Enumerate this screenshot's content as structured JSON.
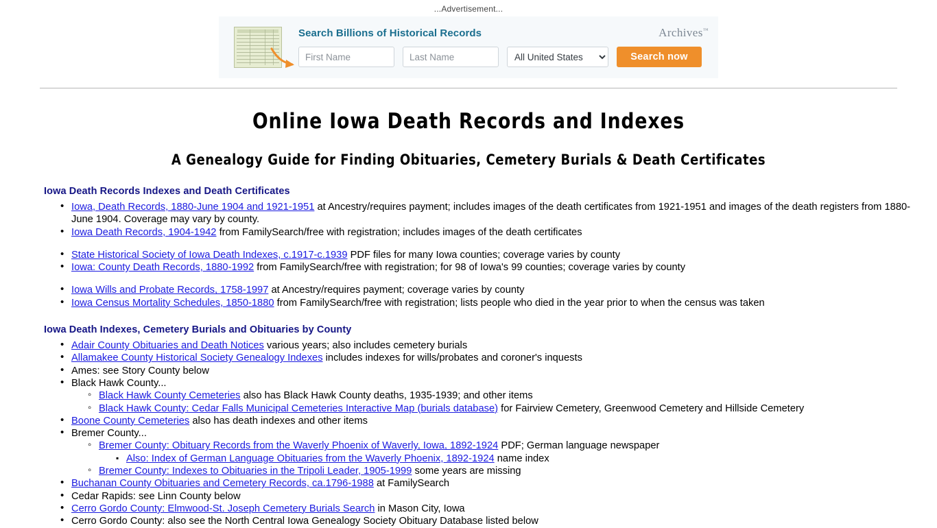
{
  "advertisement": {
    "label": "...Advertisement...",
    "headline": "Search Billions of Historical Records",
    "brand": "Archives",
    "brand_tm": "™",
    "thumbnail_name": "death-certificate-thumbnail",
    "arrow_name": "orange-arrow-pointing-to-first-name",
    "first_name_placeholder": "First Name",
    "first_name_value": "",
    "last_name_placeholder": "Last Name",
    "last_name_value": "",
    "location_selected": "All United States",
    "location_options": [
      "All United States"
    ],
    "search_button": "Search now",
    "accent_color": "#ef8f2b",
    "headline_color": "#1a6e8e",
    "box_background": "#f6f9fb"
  },
  "page": {
    "title": "Online Iowa Death Records and Indexes",
    "subtitle": "A Genealogy Guide for Finding Obituaries, Cemetery Burials & Death Certificates",
    "heading_color": "#151585",
    "link_color": "#1a1ae0"
  },
  "sections": [
    {
      "heading": "Iowa Death Records Indexes and Death Certificates",
      "items": [
        {
          "link": "Iowa, Death Records, 1880-June 1904 and 1921-1951",
          "text": " at Ancestry/requires payment; includes images of the death certificates from 1921-1951 and images of the death registers from 1880-June 1904. Coverage may vary by county."
        },
        {
          "link": "Iowa Death Records, 1904-1942",
          "text": " from FamilySearch/free with registration; includes images of the death certificates"
        },
        {
          "gap": true
        },
        {
          "link": "State Historical Society of Iowa Death Indexes, c.1917-c.1939",
          "text": " PDF files for many Iowa counties; coverage varies by county"
        },
        {
          "link": "Iowa: County Death Records, 1880-1992",
          "text": " from FamilySearch/free with registration; for 98 of Iowa's 99 counties; coverage varies by county"
        },
        {
          "gap": true
        },
        {
          "link": "Iowa Wills and Probate Records, 1758-1997",
          "text": " at Ancestry/requires payment; coverage varies by county"
        },
        {
          "link": "Iowa Census Mortality Schedules, 1850-1880",
          "text": " from FamilySearch/free with registration; lists people who died in the year prior to when the census was taken"
        }
      ]
    },
    {
      "heading": "Iowa Death Indexes, Cemetery Burials and Obituaries by County",
      "items": [
        {
          "link": "Adair County Obituaries and Death Notices",
          "text": " various years; also includes cemetery burials"
        },
        {
          "link": "Allamakee County Historical Society Genealogy Indexes",
          "text": " includes indexes for wills/probates and coroner's inquests"
        },
        {
          "link": "",
          "text": "Ames: see Story County below"
        },
        {
          "link": "",
          "text": "Black Hawk County...",
          "children": [
            {
              "link": "Black Hawk County Cemeteries",
              "text": " also has Black Hawk County deaths, 1935-1939; and other items"
            },
            {
              "link": "Black Hawk County: Cedar Falls Municipal Cemeteries Interactive Map (burials database)",
              "text": " for Fairview Cemetery, Greenwood Cemetery and Hillside Cemetery"
            }
          ]
        },
        {
          "link": "Boone County Cemeteries",
          "text": " also has death indexes and other items"
        },
        {
          "link": "",
          "text": "Bremer County...",
          "children": [
            {
              "link": "Bremer County: Obituary Records from the Waverly Phoenix of Waverly, Iowa, 1892-1924",
              "text": " PDF; German language newspaper",
              "children": [
                {
                  "link": "Also: Index of German Language Obituaries from the Waverly Phoenix, 1892-1924",
                  "text": " name index"
                }
              ]
            },
            {
              "link": "Bremer County: Indexes to Obituaries in the Tripoli Leader, 1905-1999",
              "text": " some years are missing"
            }
          ]
        },
        {
          "link": "Buchanan County Obituaries and Cemetery Records, ca.1796-1988",
          "text": " at FamilySearch"
        },
        {
          "link": "",
          "text": "Cedar Rapids: see Linn County below"
        },
        {
          "link": "Cerro Gordo County: Elmwood-St. Joseph Cemetery Burials Search",
          "text": " in Mason City, Iowa"
        },
        {
          "link": "",
          "text": "Cerro Gordo County: also see the North Central Iowa Genealogy Society Obituary Database listed below"
        }
      ]
    }
  ]
}
